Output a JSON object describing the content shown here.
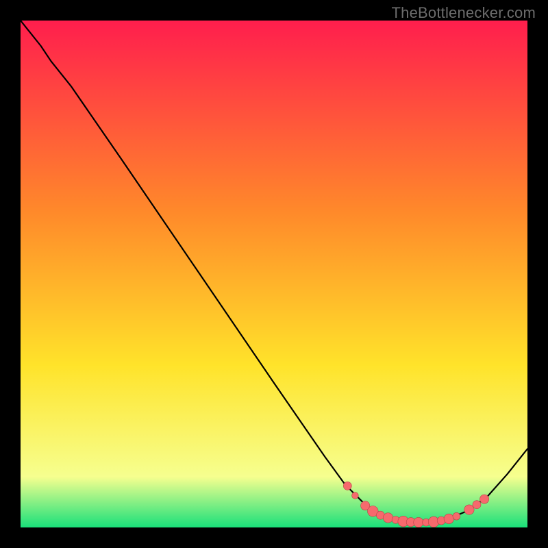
{
  "watermark": "TheBottlenecker.com",
  "colors": {
    "frame": "#000000",
    "curve": "#000000",
    "marker_fill": "#f66a6d",
    "marker_stroke": "#b74345",
    "grad_top": "#ff1e4d",
    "grad_mid1": "#ff8a2a",
    "grad_mid2": "#ffe32a",
    "grad_low": "#f6ff8f",
    "grad_bottom": "#19e07a"
  },
  "chart_data": {
    "type": "line",
    "title": "",
    "xlabel": "",
    "ylabel": "",
    "xlim": [
      0,
      100
    ],
    "ylim": [
      0,
      100
    ],
    "curve": [
      {
        "x": 0,
        "y": 100
      },
      {
        "x": 4,
        "y": 95
      },
      {
        "x": 6,
        "y": 92
      },
      {
        "x": 10,
        "y": 87
      },
      {
        "x": 20,
        "y": 72.5
      },
      {
        "x": 35,
        "y": 50.5
      },
      {
        "x": 50,
        "y": 28.5
      },
      {
        "x": 60,
        "y": 14
      },
      {
        "x": 64,
        "y": 8.5
      },
      {
        "x": 68,
        "y": 4.5
      },
      {
        "x": 72,
        "y": 2.2
      },
      {
        "x": 76,
        "y": 1.2
      },
      {
        "x": 80,
        "y": 1.0
      },
      {
        "x": 84,
        "y": 1.5
      },
      {
        "x": 88,
        "y": 3.2
      },
      {
        "x": 92,
        "y": 6.0
      },
      {
        "x": 96,
        "y": 10.5
      },
      {
        "x": 100,
        "y": 15.5
      }
    ],
    "markers": [
      {
        "x": 64.5,
        "y": 8.2,
        "r": 1.0
      },
      {
        "x": 66.0,
        "y": 6.3,
        "r": 0.8
      },
      {
        "x": 68.0,
        "y": 4.3,
        "r": 1.1
      },
      {
        "x": 69.5,
        "y": 3.2,
        "r": 1.3
      },
      {
        "x": 71.0,
        "y": 2.4,
        "r": 1.0
      },
      {
        "x": 72.5,
        "y": 1.9,
        "r": 1.2
      },
      {
        "x": 74.0,
        "y": 1.5,
        "r": 0.9
      },
      {
        "x": 75.5,
        "y": 1.2,
        "r": 1.3
      },
      {
        "x": 77.0,
        "y": 1.05,
        "r": 1.1
      },
      {
        "x": 78.5,
        "y": 1.0,
        "r": 1.2
      },
      {
        "x": 80.0,
        "y": 1.0,
        "r": 0.9
      },
      {
        "x": 81.5,
        "y": 1.1,
        "r": 1.3
      },
      {
        "x": 83.0,
        "y": 1.35,
        "r": 1.0
      },
      {
        "x": 84.5,
        "y": 1.7,
        "r": 1.2
      },
      {
        "x": 86.0,
        "y": 2.2,
        "r": 0.9
      },
      {
        "x": 88.5,
        "y": 3.5,
        "r": 1.2
      },
      {
        "x": 90.0,
        "y": 4.5,
        "r": 1.0
      },
      {
        "x": 91.5,
        "y": 5.6,
        "r": 1.1
      }
    ]
  }
}
